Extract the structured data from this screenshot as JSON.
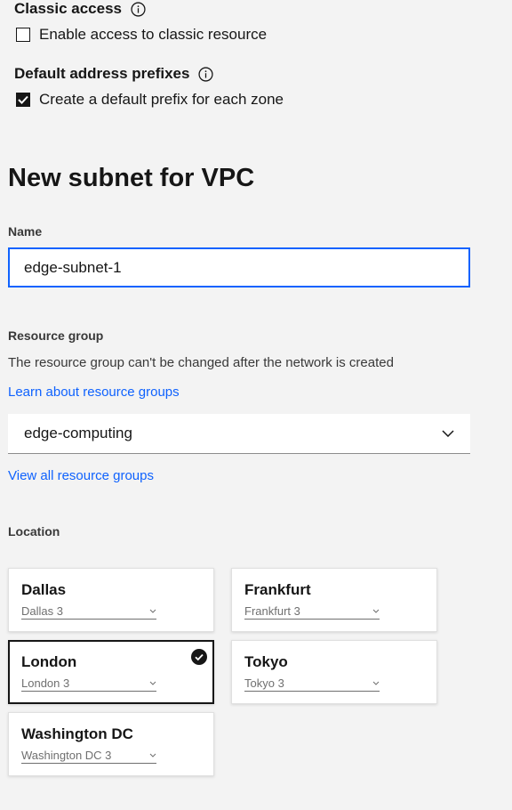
{
  "classic_access": {
    "label": "Classic access",
    "checkbox_label": "Enable access to classic resource",
    "checked": false
  },
  "default_prefixes": {
    "label": "Default address prefixes",
    "checkbox_label": "Create a default prefix for each zone",
    "checked": true
  },
  "subnet": {
    "title": "New subnet for VPC",
    "name_label": "Name",
    "name_value": "edge-subnet-1"
  },
  "resource_group": {
    "label": "Resource group",
    "helper": "The resource group can't be changed after the network is created",
    "learn_link": "Learn about resource groups",
    "selected": "edge-computing",
    "view_all_link": "View all resource groups"
  },
  "location": {
    "label": "Location",
    "tiles": [
      {
        "name": "Dallas",
        "zone": "Dallas 3",
        "selected": false
      },
      {
        "name": "Frankfurt",
        "zone": "Frankfurt 3",
        "selected": false
      },
      {
        "name": "London",
        "zone": "London 3",
        "selected": true
      },
      {
        "name": "Tokyo",
        "zone": "Tokyo 3",
        "selected": false
      },
      {
        "name": "Washington DC",
        "zone": "Washington DC 3",
        "selected": false
      }
    ]
  },
  "colors": {
    "accent": "#0f62fe",
    "text": "#161616",
    "background": "#f3f3f3"
  },
  "icons": {
    "info": "info-icon",
    "checkmark": "checkmark-icon",
    "chevron": "chevron-down-icon",
    "selected": "checkmark-filled-icon"
  }
}
